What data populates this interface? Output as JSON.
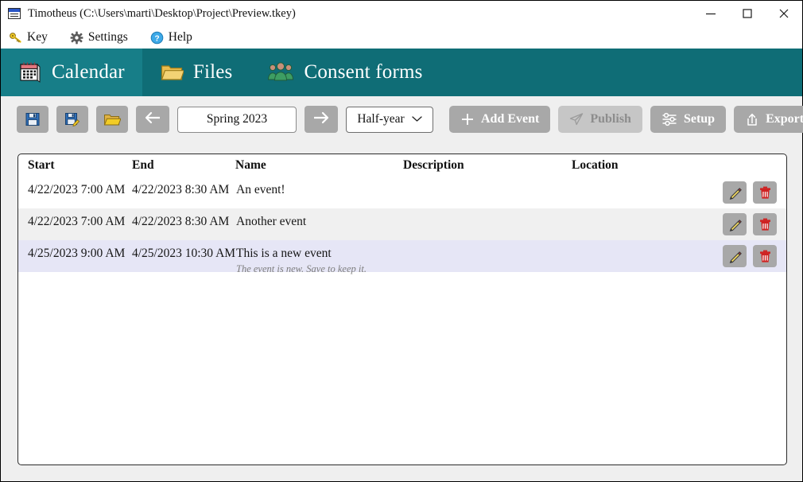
{
  "window": {
    "title": "Timotheus (C:\\Users\\marti\\Desktop\\Project\\Preview.tkey)",
    "icon": "document-icon",
    "controls": {
      "minimize": "minimize-icon",
      "maximize": "maximize-icon",
      "close": "close-icon"
    }
  },
  "menubar": {
    "items": [
      {
        "label": "Key",
        "icon": "key-icon"
      },
      {
        "label": "Settings",
        "icon": "gear-icon"
      },
      {
        "label": "Help",
        "icon": "help-circle-icon"
      }
    ]
  },
  "tabs": [
    {
      "label": "Calendar",
      "icon": "calendar-icon",
      "active": true
    },
    {
      "label": "Files",
      "icon": "folder-icon",
      "active": false
    },
    {
      "label": "Consent forms",
      "icon": "people-icon",
      "active": false
    }
  ],
  "toolbar": {
    "save": {
      "icon": "save-icon",
      "tooltip": "Save"
    },
    "save_as": {
      "icon": "save-as-icon",
      "tooltip": "Save As"
    },
    "open": {
      "icon": "open-folder-icon",
      "tooltip": "Open"
    },
    "prev": {
      "icon": "arrow-left-icon"
    },
    "period_value": "Spring 2023",
    "next": {
      "icon": "arrow-right-icon"
    },
    "range_select": {
      "value": "Half-year",
      "icon": "chevron-down-icon",
      "options": [
        "Half-year"
      ]
    },
    "add_event": {
      "label": "Add Event",
      "icon": "plus-icon",
      "enabled": true
    },
    "publish": {
      "label": "Publish",
      "icon": "send-icon",
      "enabled": false
    },
    "setup": {
      "label": "Setup",
      "icon": "sliders-icon",
      "enabled": true
    },
    "export": {
      "label": "Export",
      "icon": "export-icon",
      "enabled": true
    }
  },
  "table": {
    "columns": [
      "Start",
      "End",
      "Name",
      "Description",
      "Location"
    ],
    "rows": [
      {
        "start": "4/22/2023 7:00 AM",
        "end": "4/22/2023 8:30 AM",
        "name": "An event!",
        "note": "",
        "description": "",
        "location": "",
        "state": "white",
        "edit_icon": "pencil-icon",
        "delete_icon": "trash-icon"
      },
      {
        "start": "4/22/2023 7:00 AM",
        "end": "4/22/2023 8:30 AM",
        "name": "Another event",
        "note": "",
        "description": "",
        "location": "",
        "state": "gray",
        "edit_icon": "pencil-icon",
        "delete_icon": "trash-icon"
      },
      {
        "start": "4/25/2023 9:00 AM",
        "end": "4/25/2023 10:30 AM",
        "name": "This is a new event",
        "note": "The event is new. Save to keep it.",
        "description": "",
        "location": "",
        "state": "selected",
        "edit_icon": "pencil-icon",
        "delete_icon": "trash-icon"
      }
    ]
  },
  "colors": {
    "tabbar": "#0f6d76",
    "tab_active": "#177e88",
    "button_gray": "#a8a8a8",
    "button_disabled": "#c6c6c6",
    "row_selected": "#e6e6f6",
    "row_alt": "#f0f0f0"
  }
}
